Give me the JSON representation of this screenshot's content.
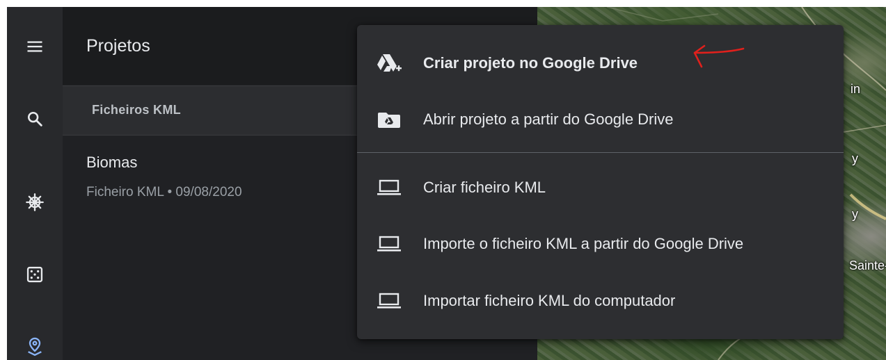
{
  "rail": {
    "items": [
      {
        "icon": "menu-icon"
      },
      {
        "icon": "search-icon"
      },
      {
        "icon": "voyager-wheel-icon"
      },
      {
        "icon": "feeling-lucky-dice-icon"
      },
      {
        "icon": "projects-pin-icon"
      }
    ],
    "active_color": "#8ab4f8"
  },
  "panel": {
    "title": "Projetos",
    "section_label": "Ficheiros KML",
    "projects": [
      {
        "name": "Biomas",
        "meta": "Ficheiro KML • 09/08/2020"
      }
    ]
  },
  "map": {
    "labels": [
      "in",
      "y",
      "y",
      "Sainte-"
    ]
  },
  "menu": {
    "items": [
      {
        "label": "Criar projeto no Google Drive",
        "icon": "drive-add-icon",
        "bold": true
      },
      {
        "label": "Abrir projeto a partir do Google Drive",
        "icon": "drive-folder-icon"
      },
      {
        "label": "Criar ficheiro KML",
        "icon": "laptop-icon"
      },
      {
        "label": "Importe o ficheiro KML a partir do Google Drive",
        "icon": "laptop-icon"
      },
      {
        "label": "Importar ficheiro KML do computador",
        "icon": "laptop-icon"
      }
    ]
  },
  "annotation": {
    "color": "#e0201c",
    "shape": "hand-drawn-arrow"
  }
}
